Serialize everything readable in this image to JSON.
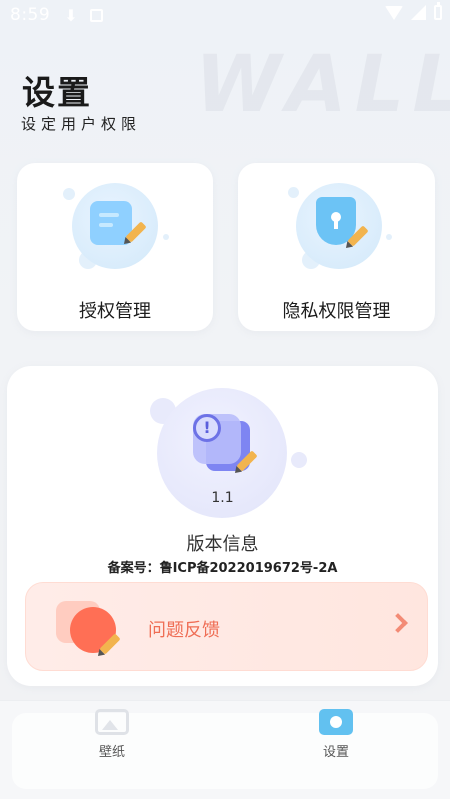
{
  "status_bar": {
    "time": "8:59",
    "icons": [
      "download-icon",
      "app-notification-icon",
      "wifi-icon",
      "signal-icon",
      "battery-icon"
    ]
  },
  "header": {
    "watermark": "WALL",
    "title": "设置",
    "subtitle": "设定用户权限"
  },
  "cards": {
    "authorization": {
      "label": "授权管理",
      "icon": "document-edit-icon"
    },
    "privacy": {
      "label": "隐私权限管理",
      "icon": "shield-lock-icon"
    }
  },
  "version": {
    "icon": "warning-document-icon",
    "number": "1.1",
    "title": "版本信息",
    "record": "备案号：鲁ICP备2022019672号-2A"
  },
  "feedback": {
    "label": "问题反馈",
    "icon": "feedback-icon",
    "accent": "#ef6e55"
  },
  "tabbar": {
    "tabs": [
      {
        "label": "壁纸",
        "icon": "image-icon",
        "active": false
      },
      {
        "label": "设置",
        "icon": "settings-icon",
        "active": true
      }
    ]
  }
}
